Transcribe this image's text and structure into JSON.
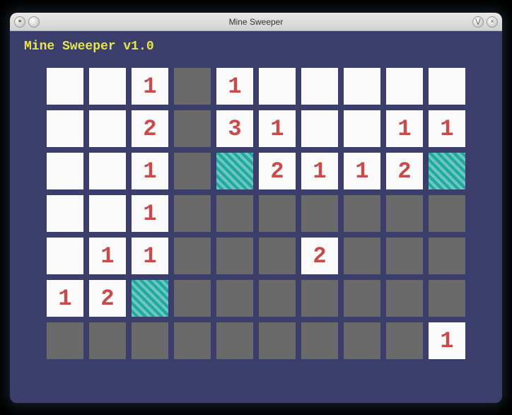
{
  "window": {
    "title": "Mine Sweeper",
    "app_icon": "mine-icon",
    "min_icon": "circle-icon",
    "close_icon": "close-icon",
    "expand_icon": "expand-icon"
  },
  "version_text": "Mine Sweeper v1.0",
  "grid": {
    "cols": 10,
    "rows": 7,
    "cells": [
      [
        {
          "s": "covered",
          "v": ""
        },
        {
          "s": "covered",
          "v": ""
        },
        {
          "s": "covered",
          "v": "1"
        },
        {
          "s": "revealed",
          "v": ""
        },
        {
          "s": "covered",
          "v": "1"
        },
        {
          "s": "covered",
          "v": ""
        },
        {
          "s": "covered",
          "v": ""
        },
        {
          "s": "covered",
          "v": ""
        },
        {
          "s": "covered",
          "v": ""
        },
        {
          "s": "covered",
          "v": ""
        }
      ],
      [
        {
          "s": "covered",
          "v": ""
        },
        {
          "s": "covered",
          "v": ""
        },
        {
          "s": "covered",
          "v": "2"
        },
        {
          "s": "revealed",
          "v": ""
        },
        {
          "s": "covered",
          "v": "3"
        },
        {
          "s": "covered",
          "v": "1"
        },
        {
          "s": "covered",
          "v": ""
        },
        {
          "s": "covered",
          "v": ""
        },
        {
          "s": "covered",
          "v": "1"
        },
        {
          "s": "covered",
          "v": "1"
        }
      ],
      [
        {
          "s": "covered",
          "v": ""
        },
        {
          "s": "covered",
          "v": ""
        },
        {
          "s": "covered",
          "v": "1"
        },
        {
          "s": "revealed",
          "v": ""
        },
        {
          "s": "flagged",
          "v": ""
        },
        {
          "s": "covered",
          "v": "2"
        },
        {
          "s": "covered",
          "v": "1"
        },
        {
          "s": "covered",
          "v": "1"
        },
        {
          "s": "covered",
          "v": "2"
        },
        {
          "s": "flagged",
          "v": ""
        }
      ],
      [
        {
          "s": "covered",
          "v": ""
        },
        {
          "s": "covered",
          "v": ""
        },
        {
          "s": "covered",
          "v": "1"
        },
        {
          "s": "revealed",
          "v": ""
        },
        {
          "s": "revealed",
          "v": ""
        },
        {
          "s": "revealed",
          "v": ""
        },
        {
          "s": "revealed",
          "v": ""
        },
        {
          "s": "revealed",
          "v": ""
        },
        {
          "s": "revealed",
          "v": ""
        },
        {
          "s": "revealed",
          "v": ""
        }
      ],
      [
        {
          "s": "covered",
          "v": ""
        },
        {
          "s": "covered",
          "v": "1"
        },
        {
          "s": "covered",
          "v": "1"
        },
        {
          "s": "revealed",
          "v": ""
        },
        {
          "s": "revealed",
          "v": ""
        },
        {
          "s": "revealed",
          "v": ""
        },
        {
          "s": "covered",
          "v": "2"
        },
        {
          "s": "revealed",
          "v": ""
        },
        {
          "s": "revealed",
          "v": ""
        },
        {
          "s": "revealed",
          "v": ""
        }
      ],
      [
        {
          "s": "covered",
          "v": "1"
        },
        {
          "s": "covered",
          "v": "2"
        },
        {
          "s": "flagged",
          "v": ""
        },
        {
          "s": "revealed",
          "v": ""
        },
        {
          "s": "revealed",
          "v": ""
        },
        {
          "s": "revealed",
          "v": ""
        },
        {
          "s": "revealed",
          "v": ""
        },
        {
          "s": "revealed",
          "v": ""
        },
        {
          "s": "revealed",
          "v": ""
        },
        {
          "s": "revealed",
          "v": ""
        }
      ],
      [
        {
          "s": "revealed",
          "v": ""
        },
        {
          "s": "revealed",
          "v": ""
        },
        {
          "s": "revealed",
          "v": ""
        },
        {
          "s": "revealed",
          "v": ""
        },
        {
          "s": "revealed",
          "v": ""
        },
        {
          "s": "revealed",
          "v": ""
        },
        {
          "s": "revealed",
          "v": ""
        },
        {
          "s": "revealed",
          "v": ""
        },
        {
          "s": "revealed",
          "v": ""
        },
        {
          "s": "covered",
          "v": "1"
        }
      ]
    ]
  }
}
